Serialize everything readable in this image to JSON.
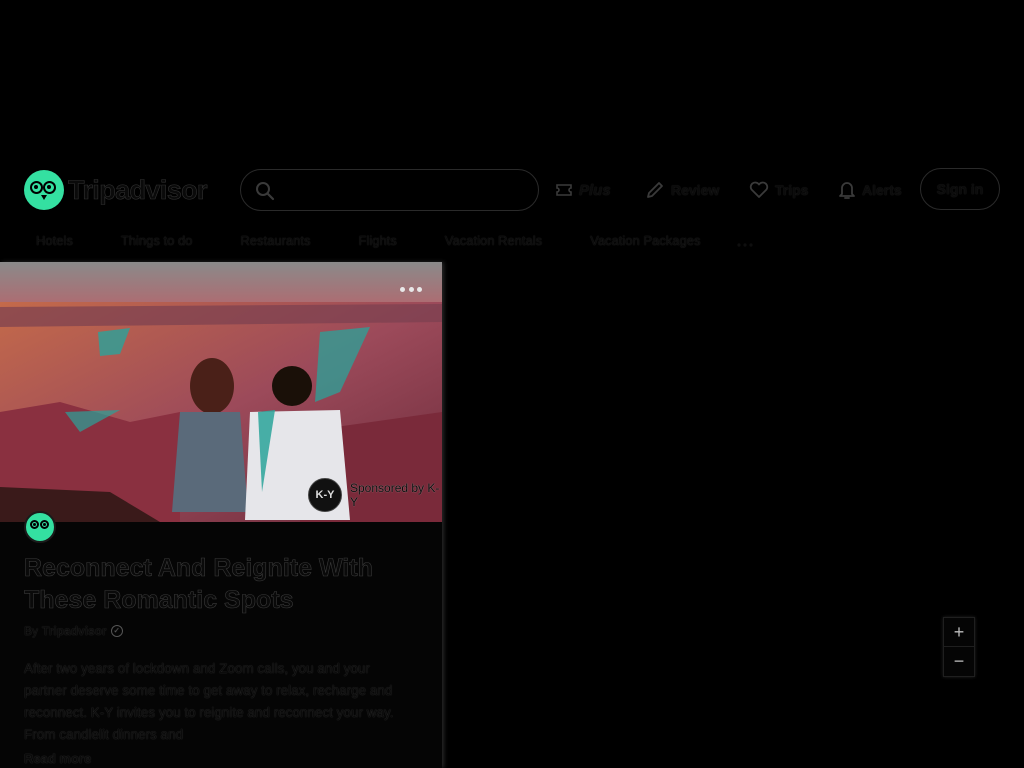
{
  "header": {
    "logo_text": "Tripadvisor",
    "search_placeholder": "",
    "plus_label": "Plus",
    "review_label": "Review",
    "trips_label": "Trips",
    "alerts_label": "Alerts",
    "signin_label": "Sign in"
  },
  "nav": {
    "items": [
      "Hotels",
      "Things to do",
      "Restaurants",
      "Flights",
      "Vacation Rentals",
      "Vacation Packages"
    ],
    "more_label": "..."
  },
  "card": {
    "sponsor_logo": "K-Y",
    "sponsor_text": "Sponsored by K-Y",
    "title": "Reconnect And Reignite With These Romantic Spots",
    "byline_prefix": "By",
    "author": "Tripadvisor",
    "body": "After two years of lockdown and Zoom calls, you and your partner deserve some time to get away to relax, recharge and reconnect. K-Y invites you to reignite and reconnect your way. From candlelit dinners and",
    "read_more": "Read more"
  },
  "map": {
    "zoom_in": "+",
    "zoom_out": "−"
  },
  "colors": {
    "brand": "#34e0a1",
    "background": "#000000"
  }
}
